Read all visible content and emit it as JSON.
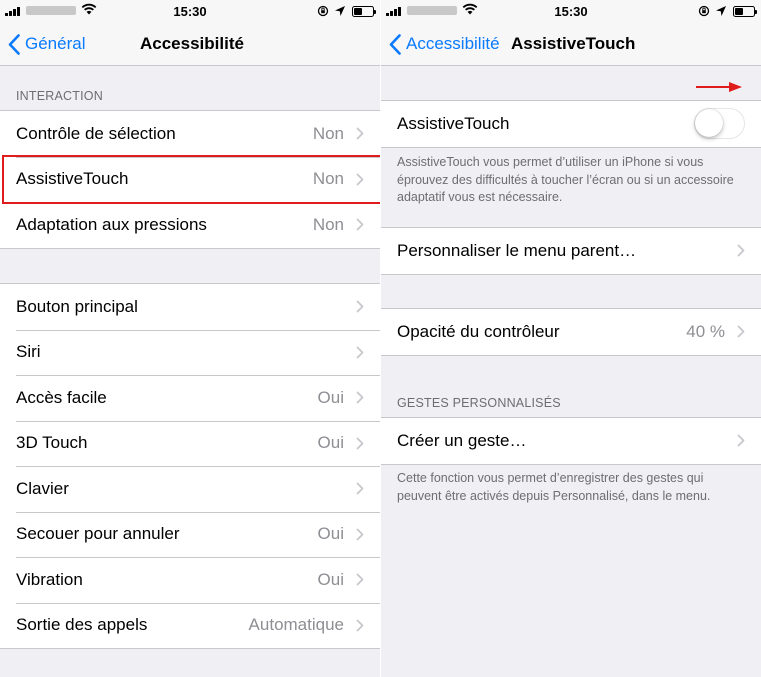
{
  "colors": {
    "accent": "#0a7aff",
    "highlight": "#e01b1b",
    "background": "#efeff4",
    "secondary_text": "#8e8e93"
  },
  "status_bar": {
    "time": "15:30"
  },
  "left": {
    "back_label": "Général",
    "title": "Accessibilité",
    "interaction_header": "INTERACTION",
    "interaction_rows": [
      {
        "label": "Contrôle de sélection",
        "value": "Non"
      },
      {
        "label": "AssistiveTouch",
        "value": "Non"
      },
      {
        "label": "Adaptation aux pressions",
        "value": "Non"
      }
    ],
    "rows": [
      {
        "label": "Bouton principal",
        "value": ""
      },
      {
        "label": "Siri",
        "value": ""
      },
      {
        "label": "Accès facile",
        "value": "Oui"
      },
      {
        "label": "3D Touch",
        "value": "Oui"
      },
      {
        "label": "Clavier",
        "value": ""
      },
      {
        "label": "Secouer pour annuler",
        "value": "Oui"
      },
      {
        "label": "Vibration",
        "value": "Oui"
      },
      {
        "label": "Sortie des appels",
        "value": "Automatique"
      }
    ]
  },
  "right": {
    "back_label": "Accessibilité",
    "title": "AssistiveTouch",
    "toggle_label": "AssistiveTouch",
    "toggle_on": false,
    "description": "AssistiveTouch vous permet d’utiliser un iPhone si vous éprouvez des difficultés à toucher l’écran ou si un accessoire adaptatif vous est nécessaire.",
    "customize_label": "Personnaliser le menu parent…",
    "opacity_label": "Opacité du contrôleur",
    "opacity_value": "40 %",
    "gestures_header": "GESTES PERSONNALISÉS",
    "create_gesture_label": "Créer un geste…",
    "gestures_footer": "Cette fonction vous permet d’enregistrer des gestes qui peuvent être activés depuis Personnalisé, dans le menu."
  }
}
